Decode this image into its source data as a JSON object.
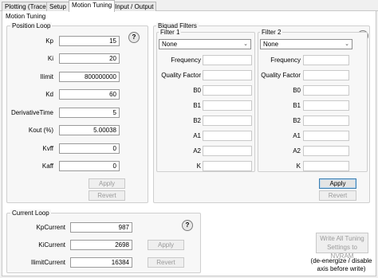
{
  "tabs": [
    {
      "label": "Plotting (Trace)"
    },
    {
      "label": "Setup"
    },
    {
      "label": "Motion Tuning"
    },
    {
      "label": "Input / Output"
    }
  ],
  "page_title": "Motion Tuning",
  "position_loop": {
    "title": "Position Loop",
    "help": "?",
    "rows": [
      {
        "label": "Kp",
        "value": "15"
      },
      {
        "label": "Ki",
        "value": "20"
      },
      {
        "label": "Ilimit",
        "value": "800000000"
      },
      {
        "label": "Kd",
        "value": "60"
      },
      {
        "label": "DerivativeTime",
        "value": "5"
      },
      {
        "label": "Kout (%)",
        "value": "5.00038"
      },
      {
        "label": "Kvff",
        "value": "0"
      },
      {
        "label": "Kaff",
        "value": "0"
      }
    ],
    "apply": "Apply",
    "revert": "Revert"
  },
  "current_loop": {
    "title": "Current Loop",
    "help": "?",
    "rows": [
      {
        "label": "KpCurrent",
        "value": "987"
      },
      {
        "label": "KiCurrent",
        "value": "2698"
      },
      {
        "label": "IlimitCurrent",
        "value": "16384"
      }
    ],
    "apply": "Apply",
    "revert": "Revert"
  },
  "biquad": {
    "title": "Biquad Filters",
    "help": "?",
    "filters": [
      {
        "title": "Filter 1",
        "type": "None",
        "frequency_label": "Frequency",
        "quality_label": "Quality Factor",
        "coeffs": [
          {
            "label": "B0"
          },
          {
            "label": "B1"
          },
          {
            "label": "B2"
          },
          {
            "label": "A1"
          },
          {
            "label": "A2"
          },
          {
            "label": "K"
          }
        ]
      },
      {
        "title": "Filter 2",
        "type": "None",
        "frequency_label": "Frequency",
        "quality_label": "Quality Factor",
        "coeffs": [
          {
            "label": "B0"
          },
          {
            "label": "B1"
          },
          {
            "label": "B2"
          },
          {
            "label": "A1"
          },
          {
            "label": "A2"
          },
          {
            "label": "K"
          }
        ]
      }
    ],
    "apply": "Apply",
    "revert": "Revert"
  },
  "nvram": {
    "button_line1": "Write All Tuning",
    "button_line2": "Settings to NVRAM",
    "note_line1": "(de-energize / disable",
    "note_line2": "axis before write)"
  },
  "colors": {
    "tab_active": "#ffffff",
    "group_bg": "#f7f7f7",
    "focus_border": "#3c7fb1"
  }
}
